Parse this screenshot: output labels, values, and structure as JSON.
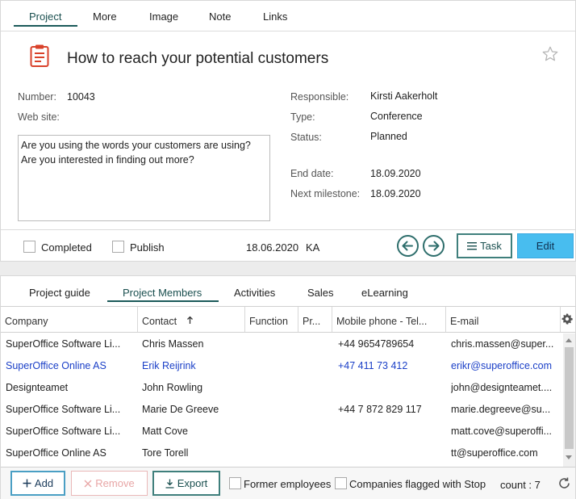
{
  "project_tabs": [
    "Project",
    "More",
    "Image",
    "Note",
    "Links"
  ],
  "project": {
    "title": "How to reach your potential customers",
    "number_label": "Number:",
    "number": "10043",
    "website_label": "Web site:",
    "website": "",
    "description_line1": "Are you using the words your customers are using?",
    "description_line2": "Are you interested in finding out more?",
    "responsible_label": "Responsible:",
    "responsible": "Kirsti Aakerholt",
    "type_label": "Type:",
    "type": "Conference",
    "status_label": "Status:",
    "status": "Planned",
    "end_date_label": "End date:",
    "end_date": "18.09.2020",
    "next_milestone_label": "Next milestone:",
    "next_milestone": "18.09.2020"
  },
  "footer": {
    "completed_label": "Completed",
    "publish_label": "Publish",
    "date": "18.06.2020",
    "initials": "KA",
    "task_label": "Task",
    "edit_label": "Edit"
  },
  "section_tabs": [
    "Project guide",
    "Project Members",
    "Activities",
    "Sales",
    "eLearning"
  ],
  "members": {
    "columns": {
      "company": "Company",
      "contact": "Contact",
      "function": "Function",
      "pr": "Pr...",
      "mobile": "Mobile phone - Tel...",
      "email": "E-mail"
    },
    "rows": [
      {
        "company": "SuperOffice Software Li...",
        "contact": "Chris Massen",
        "mobile": "+44 9654789654",
        "email": "chris.massen@super..."
      },
      {
        "company": "SuperOffice Online AS",
        "contact": "Erik Reijrink",
        "mobile": "+47 411 73 412",
        "email": "erikr@superoffice.com"
      },
      {
        "company": "Designteamet",
        "contact": "John Rowling",
        "mobile": "",
        "email": "john@designteamet...."
      },
      {
        "company": "SuperOffice Software Li...",
        "contact": "Marie De Greeve",
        "mobile": "+44 7 872 829 117",
        "email": "marie.degreeve@su..."
      },
      {
        "company": "SuperOffice Software Li...",
        "contact": "Matt Cove",
        "mobile": "",
        "email": "matt.cove@superoffi..."
      },
      {
        "company": "SuperOffice Online AS",
        "contact": "Tore Torell",
        "mobile": "",
        "email": "tt@superoffice.com"
      }
    ],
    "add_label": "Add",
    "remove_label": "Remove",
    "export_label": "Export",
    "former_employees_label": "Former employees",
    "companies_flagged_label": "Companies flagged with Stop",
    "count_text": "count : 7"
  },
  "colors": {
    "accent": "#1b5a5a",
    "edit_button": "#48bdef",
    "link": "#1a3fc7",
    "icon_red": "#d9422b"
  }
}
